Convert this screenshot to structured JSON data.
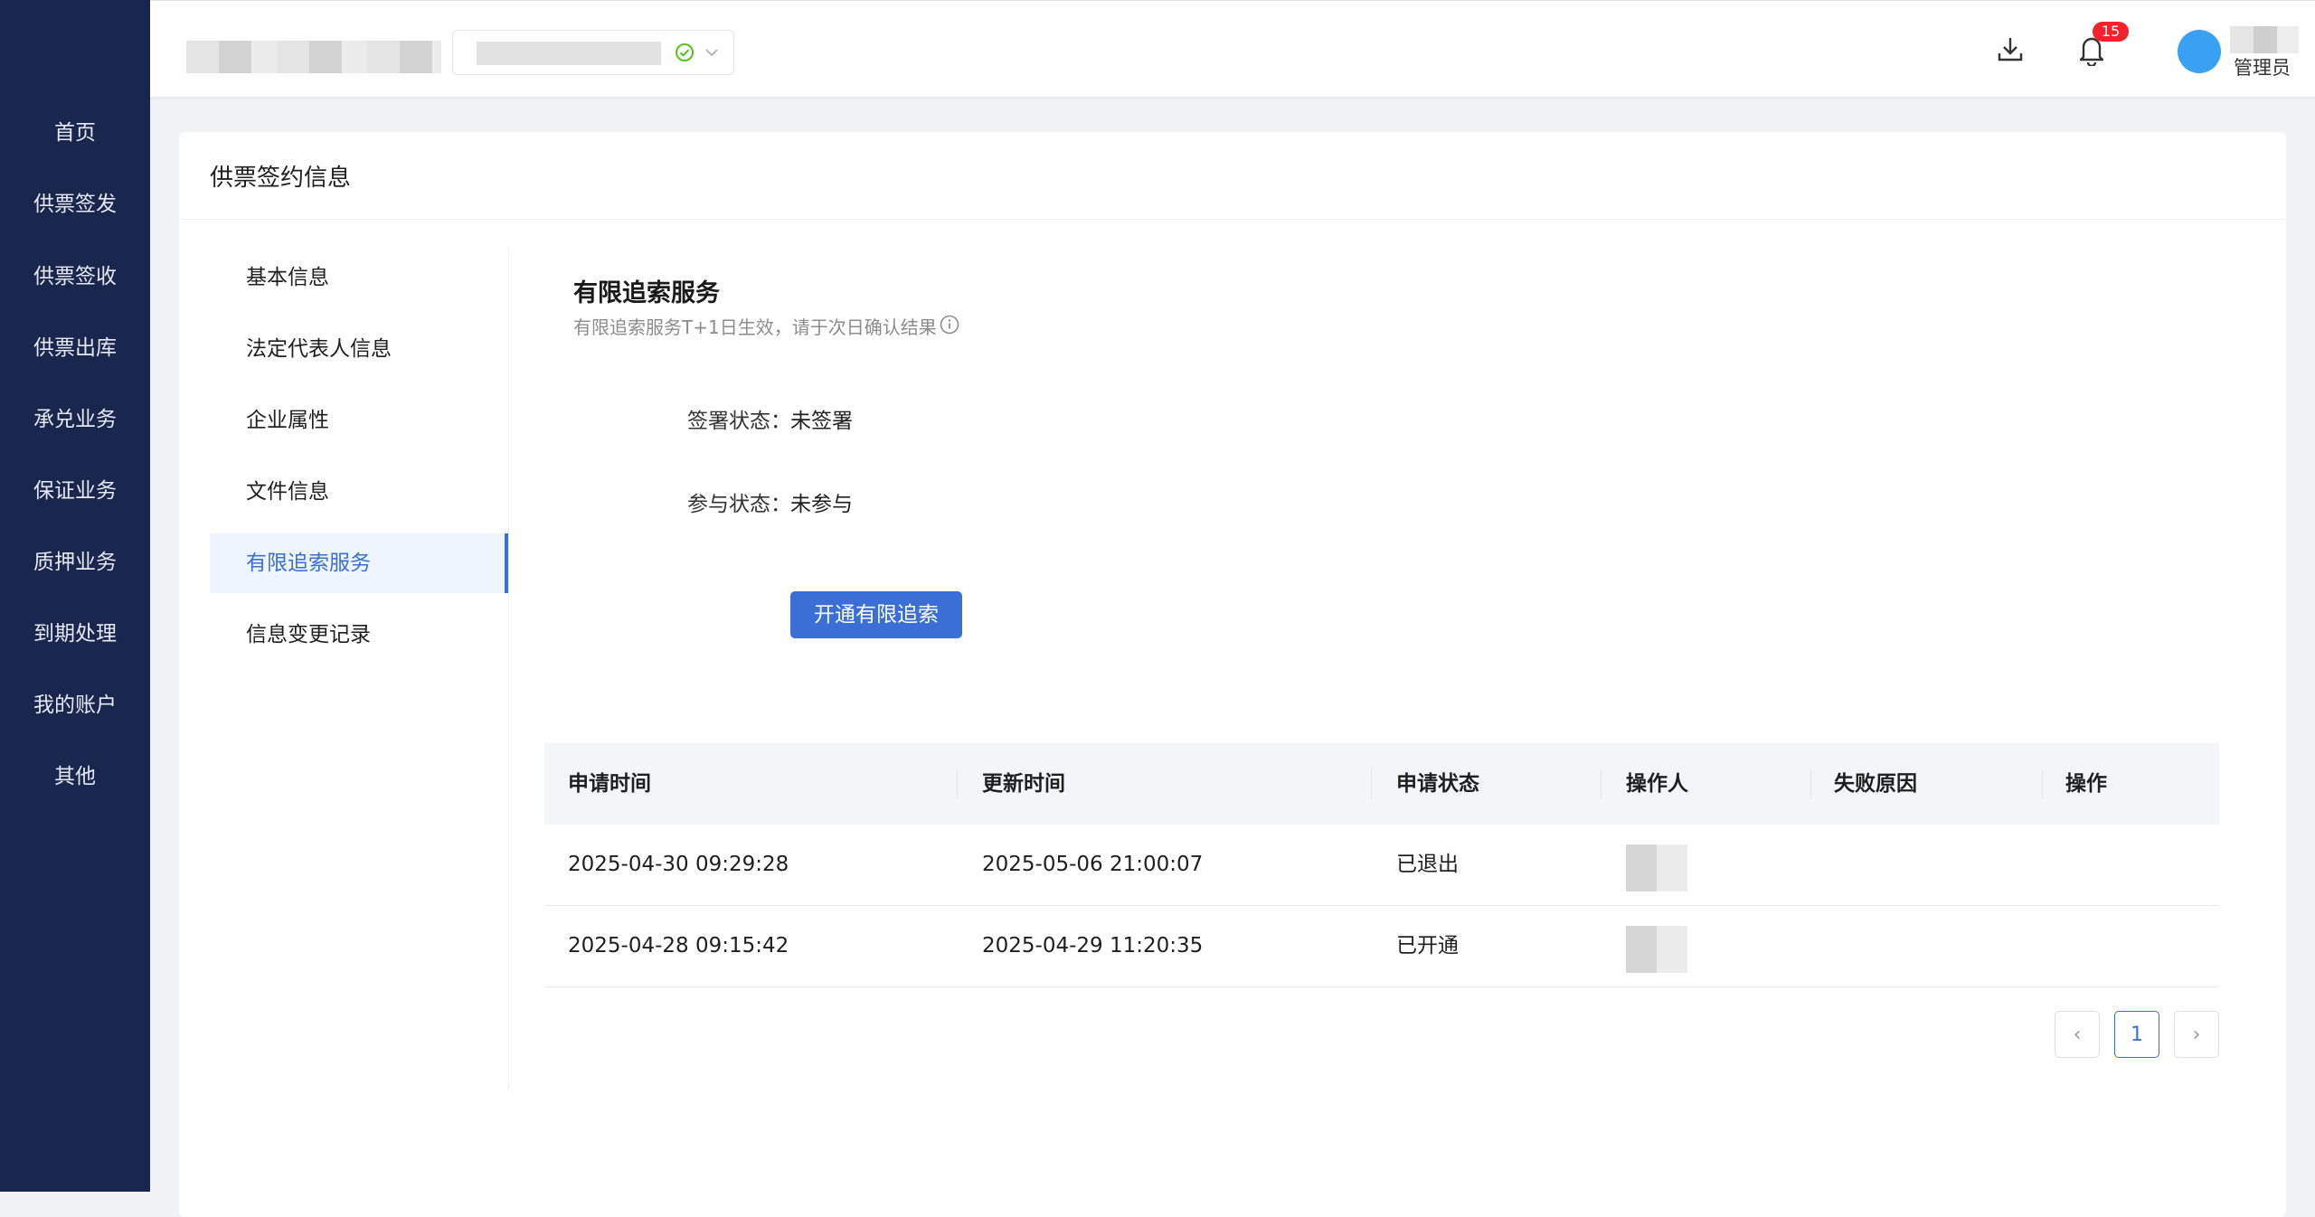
{
  "sidebar": {
    "items": [
      {
        "label": "首页"
      },
      {
        "label": "供票签发"
      },
      {
        "label": "供票签收"
      },
      {
        "label": "供票出库"
      },
      {
        "label": "承兑业务"
      },
      {
        "label": "保证业务"
      },
      {
        "label": "质押业务"
      },
      {
        "label": "到期处理"
      },
      {
        "label": "我的账户"
      },
      {
        "label": "其他"
      }
    ]
  },
  "header": {
    "notification_count": "15",
    "user_role": "管理员",
    "icons": [
      "download-icon",
      "bell-icon",
      "check-circle-icon",
      "chevron-down-icon"
    ],
    "colors": {
      "status_ok": "#52c41a",
      "badge": "#f5222d",
      "avatar": "#3aa0f3"
    }
  },
  "page": {
    "title": "供票签约信息",
    "subnav": [
      {
        "label": "基本信息"
      },
      {
        "label": "法定代表人信息"
      },
      {
        "label": "企业属性"
      },
      {
        "label": "文件信息"
      },
      {
        "label": "有限追索服务"
      },
      {
        "label": "信息变更记录"
      }
    ],
    "active_subnav": "有限追索服务"
  },
  "section": {
    "title": "有限追索服务",
    "hint": "有限追索服务T+1日生效，请于次日确认结果",
    "sign_status_label": "签署状态：",
    "sign_status_value": "未签署",
    "join_status_label": "参与状态：",
    "join_status_value": "未参与",
    "open_button": "开通有限追索"
  },
  "table": {
    "columns": [
      "申请时间",
      "更新时间",
      "申请状态",
      "操作人",
      "失败原因",
      "操作"
    ],
    "rows": [
      {
        "apply_time": "2025-04-30 09:29:28",
        "update_time": "2025-05-06 21:00:07",
        "status": "已退出",
        "fail_reason": "",
        "action": ""
      },
      {
        "apply_time": "2025-04-28 09:15:42",
        "update_time": "2025-04-29 11:20:35",
        "status": "已开通",
        "fail_reason": "",
        "action": ""
      }
    ]
  },
  "pagination": {
    "current": "1",
    "prev_symbol": "‹",
    "next_symbol": "›"
  },
  "theme": {
    "sidebar_bg": "#19264d",
    "primary": "#3b6fd6",
    "active_bg": "#eff5ff"
  }
}
